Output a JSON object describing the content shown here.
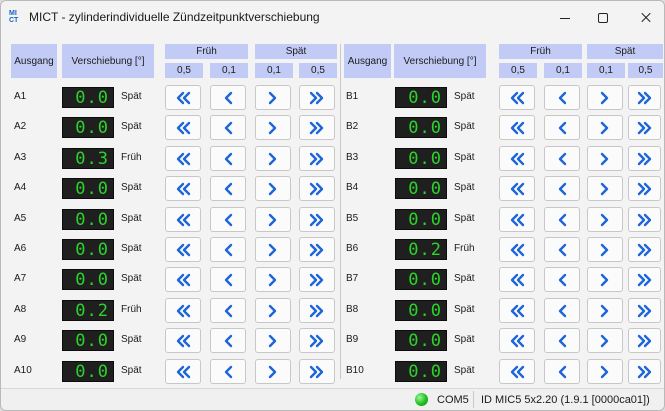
{
  "window": {
    "logo_line1": "MI",
    "logo_line2": "CT",
    "title": "MICT - zylinderindividuelle Zündzeitpunktverschiebung"
  },
  "headers": {
    "ausgang": "Ausgang",
    "verschiebung": "Verschiebung [°]",
    "frueh": "Früh",
    "spaet": "Spät",
    "step_large": "0,5",
    "step_small": "0,1"
  },
  "rows_left": [
    {
      "label": "A1",
      "value": "0.0",
      "direction": "Spät"
    },
    {
      "label": "A2",
      "value": "0.0",
      "direction": "Spät"
    },
    {
      "label": "A3",
      "value": "0.3",
      "direction": "Früh"
    },
    {
      "label": "A4",
      "value": "0.0",
      "direction": "Spät"
    },
    {
      "label": "A5",
      "value": "0.0",
      "direction": "Spät"
    },
    {
      "label": "A6",
      "value": "0.0",
      "direction": "Spät"
    },
    {
      "label": "A7",
      "value": "0.0",
      "direction": "Spät"
    },
    {
      "label": "A8",
      "value": "0.2",
      "direction": "Früh"
    },
    {
      "label": "A9",
      "value": "0.0",
      "direction": "Spät"
    },
    {
      "label": "A10",
      "value": "0.0",
      "direction": "Spät"
    }
  ],
  "rows_right": [
    {
      "label": "B1",
      "value": "0.0",
      "direction": "Spät"
    },
    {
      "label": "B2",
      "value": "0.0",
      "direction": "Spät"
    },
    {
      "label": "B3",
      "value": "0.0",
      "direction": "Spät"
    },
    {
      "label": "B4",
      "value": "0.0",
      "direction": "Spät"
    },
    {
      "label": "B5",
      "value": "0.0",
      "direction": "Spät"
    },
    {
      "label": "B6",
      "value": "0.2",
      "direction": "Früh"
    },
    {
      "label": "B7",
      "value": "0.0",
      "direction": "Spät"
    },
    {
      "label": "B8",
      "value": "0.0",
      "direction": "Spät"
    },
    {
      "label": "B9",
      "value": "0.0",
      "direction": "Spät"
    },
    {
      "label": "B10",
      "value": "0.0",
      "direction": "Spät"
    }
  ],
  "buttons": [
    "double-chevron-left-icon",
    "chevron-left-icon",
    "chevron-right-icon",
    "double-chevron-right-icon"
  ],
  "status": {
    "port": "COM5",
    "device": "ID MIC5 5x2.20 (1.9.1 [0000ca01])",
    "led_color": "#1fbf1f"
  },
  "colors": {
    "header_bg": "#c2cbf5",
    "display_bg": "#1f1f1f",
    "display_digits": "#2bd32b",
    "icon": "#1c66d8"
  }
}
